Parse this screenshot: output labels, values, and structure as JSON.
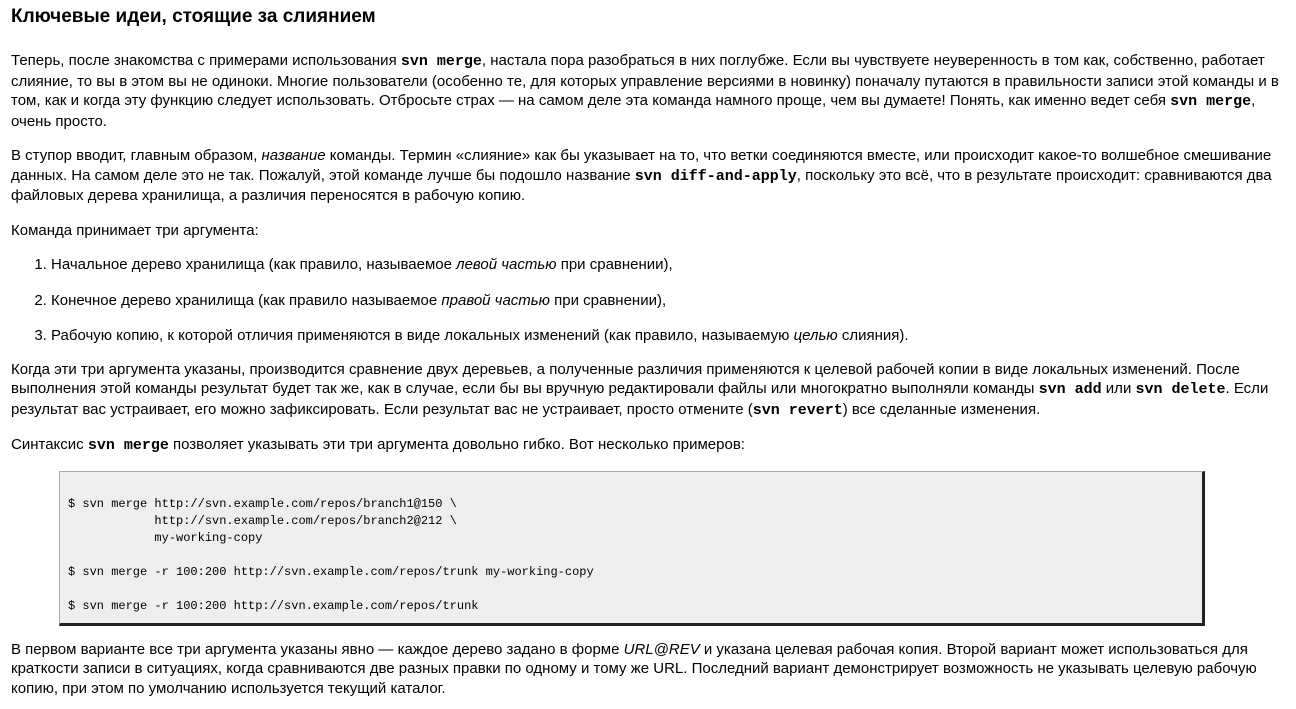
{
  "title": "Ключевые идеи, стоящие за слиянием",
  "p1": {
    "t1": "Теперь, после знакомства с примерами использования ",
    "c1": "svn merge",
    "t2": ", настала пора разобраться в них поглубже. Если вы чувствуете неуверенность в том как, собственно, работает слияние, то вы в этом вы не одиноки. Многие пользователи (особенно те, для которых управление версиями в новинку) поначалу путаются в правильности записи этой команды и в том, как и когда эту функцию следует использовать. Отбросьте страх — на самом деле эта команда намного проще, чем вы думаете! Понять, как именно ведет себя ",
    "c2": "svn merge",
    "t3": ", очень просто."
  },
  "p2": {
    "t1": "В ступор вводит, главным образом, ",
    "e1": "название",
    "t2": " команды. Термин «слияние» как бы указывает на то, что ветки соединяются вместе, или происходит какое-то волшебное смешивание данных. На самом деле это не так. Пожалуй, этой команде лучше бы подошло название ",
    "c1": "svn diff-and-apply",
    "t3": ", поскольку это всё, что в результате происходит: сравниваются два файловых дерева хранилища, а различия переносятся в рабочую копию."
  },
  "p3": "Команда принимает три аргумента:",
  "list": [
    {
      "t1": "Начальное дерево хранилища (как правило, называемое ",
      "e": "левой частью",
      "t2": " при сравнении),"
    },
    {
      "t1": "Конечное дерево хранилища (как правило называемое ",
      "e": "правой частью",
      "t2": " при сравнении),"
    },
    {
      "t1": "Рабочую копию, к которой отличия применяются в виде локальных изменений (как правило, называемую ",
      "e": "целью",
      "t2": " слияния)."
    }
  ],
  "p4": {
    "t1": "Когда эти три аргумента указаны, производится сравнение двух деревьев, а полученные различия применяются к целевой рабочей копии в виде локальных изменений. После выполнения этой команды результат будет так же, как в случае, если бы вы вручную редактировали файлы или многократно выполняли команды ",
    "c1": "svn add",
    "t2": " или ",
    "c2": "svn delete",
    "t3": ". Если результат вас устраивает, его можно зафиксировать. Если результат вас не устраивает, просто отмените (",
    "c3": "svn revert",
    "t4": ") все сделанные изменения."
  },
  "p5": {
    "t1": "Синтаксис ",
    "c1": "svn merge",
    "t2": " позволяет указывать эти три аргумента довольно гибко. Вот несколько примеров:"
  },
  "screen": "$ svn merge http://svn.example.com/repos/branch1@150 \\\n            http://svn.example.com/repos/branch2@212 \\\n            my-working-copy\n\n$ svn merge -r 100:200 http://svn.example.com/repos/trunk my-working-copy\n\n$ svn merge -r 100:200 http://svn.example.com/repos/trunk",
  "p6": {
    "t1": "В первом варианте все три аргумента указаны явно — каждое дерево задано в форме ",
    "e1": "URL@REV",
    "t2": " и указана целевая рабочая копия. Второй вариант может использоваться для краткости записи в ситуациях, когда сравниваются две разных правки по одному и тому же URL. Последний вариант демонстрирует возможность не указывать целевую рабочую копию, при этом по умолчанию используется текущий каталог."
  }
}
